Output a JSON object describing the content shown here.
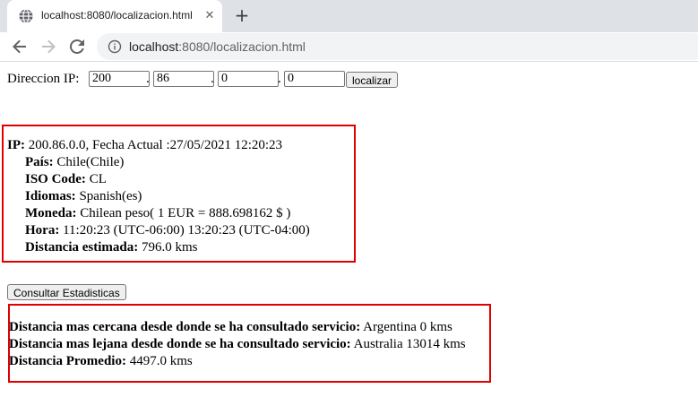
{
  "browser": {
    "tab_title": "localhost:8080/localizacion.html",
    "url_host": "localhost",
    "url_path": ":8080/localizacion.html"
  },
  "form": {
    "ip_label": "Direccion IP:",
    "octets": [
      "200",
      "86",
      "0",
      "0"
    ],
    "dot": ".",
    "locate_button": "localizar"
  },
  "result": {
    "ip_label": "IP:",
    "ip_value": "200.86.0.0, Fecha Actual :27/05/2021 12:20:23",
    "pais_label": "País:",
    "pais_value": "Chile(Chile)",
    "iso_label": "ISO Code:",
    "iso_value": "CL",
    "idiomas_label": "Idiomas:",
    "idiomas_value": "Spanish(es)",
    "moneda_label": "Moneda:",
    "moneda_value": "Chilean peso( 1 EUR = 888.698162 $ )",
    "hora_label": "Hora:",
    "hora_value": "11:20:23 (UTC-06:00) 13:20:23 (UTC-04:00)",
    "distancia_label": "Distancia estimada:",
    "distancia_value": "796.0 kms"
  },
  "stats": {
    "button": "Consultar Estadisticas",
    "cercana_label": "Distancia mas cercana desde donde se ha consultado servicio:",
    "cercana_value": "Argentina 0 kms",
    "lejana_label": "Distancia mas lejana desde donde se ha consultado servicio:",
    "lejana_value": "Australia 13014 kms",
    "promedio_label": "Distancia Promedio:",
    "promedio_value": "4497.0 kms"
  },
  "colors": {
    "highlight_border": "#e00000",
    "tabstrip": "#dee1e6",
    "omnibox": "#f1f3f4"
  },
  "icons": {
    "favicon": "globe-icon",
    "close": "close-icon",
    "new_tab": "plus-icon",
    "back": "back-arrow-icon",
    "forward": "forward-arrow-icon",
    "reload": "reload-icon",
    "site_info": "info-icon"
  }
}
